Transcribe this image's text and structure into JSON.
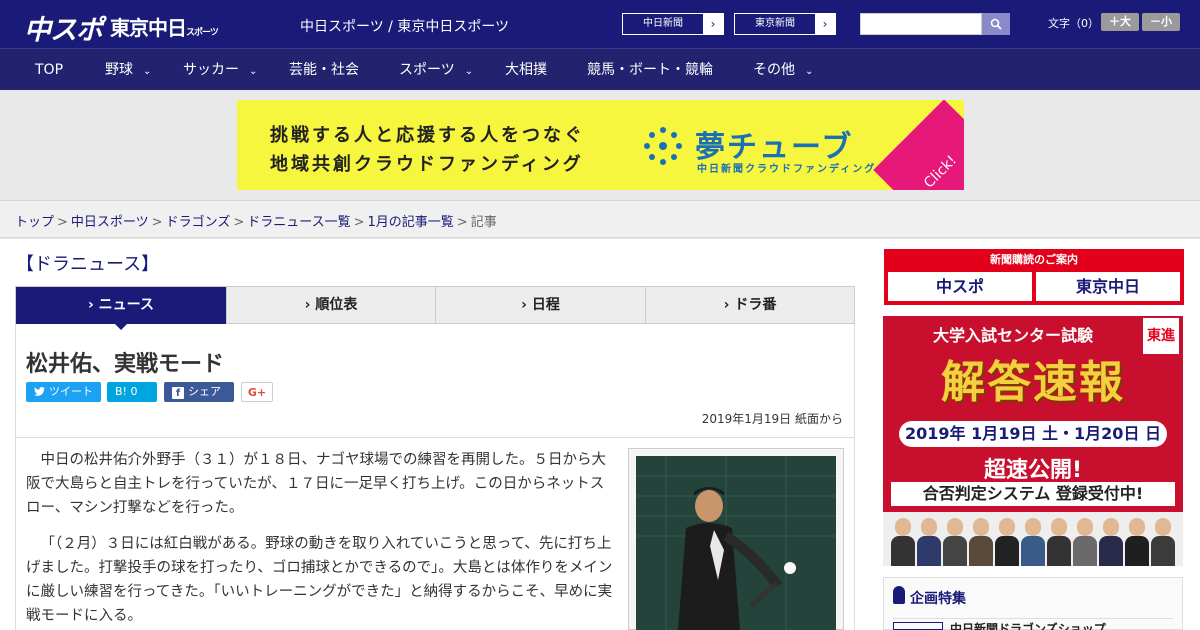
{
  "header": {
    "logo_chuspo": "中スポ",
    "logo_tokyo": "東京中日",
    "logo_tokyo_small": "スポーツ",
    "site_name": "中日スポーツ / 東京中日スポーツ",
    "links": [
      {
        "label": "中日新聞",
        "arrow": "›"
      },
      {
        "label": "東京新聞",
        "arrow": "›"
      }
    ],
    "search": {
      "placeholder": "",
      "icon": "search-icon",
      "button_symbol": "🔍"
    },
    "font_size_label": "文字（0）",
    "font_larger": "＋大",
    "font_smaller": "－小"
  },
  "nav": [
    {
      "label": "TOP",
      "has_dropdown": false
    },
    {
      "label": "野球",
      "has_dropdown": true
    },
    {
      "label": "サッカー",
      "has_dropdown": true
    },
    {
      "label": "芸能・社会",
      "has_dropdown": false
    },
    {
      "label": "スポーツ",
      "has_dropdown": true
    },
    {
      "label": "大相撲",
      "has_dropdown": false
    },
    {
      "label": "競馬・ボート・競輪",
      "has_dropdown": false
    },
    {
      "label": "その他",
      "has_dropdown": true
    }
  ],
  "nav_chevron": "⌄",
  "banner": {
    "line1": "挑戦する人と応援する人をつなぐ",
    "line2": "地域共創クラウドファンディング",
    "logo": "夢チューブ",
    "logo_sub": "中日新聞クラウドファンディング",
    "click": "Click!",
    "bg_color": "#f7f63e",
    "accent_color": "#e6197b"
  },
  "breadcrumb": {
    "items": [
      "トップ",
      "中日スポーツ",
      "ドラゴンズ",
      "ドラニュース一覧",
      "1月の記事一覧"
    ],
    "current": "記事",
    "separator": ">"
  },
  "section_title": "【ドラニュース】",
  "tabs": [
    {
      "label": "› ニュース",
      "active": true
    },
    {
      "label": "› 順位表",
      "active": false
    },
    {
      "label": "› 日程",
      "active": false
    },
    {
      "label": "› ドラ番",
      "active": false
    }
  ],
  "article": {
    "headline": "松井佑、実戦モード",
    "share": {
      "tweet": "ツイート",
      "hatena": "B! 0",
      "facebook": "シェア 0",
      "gplus": "G+"
    },
    "dateline": "2019年1月19日 紙面から",
    "paragraphs": [
      "中日の松井佑介外野手（３１）が１８日、ナゴヤ球場での練習を再開した。５日から大阪で大島らと自主トレを行っていたが、１７日に一足早く打ち上げ。この日からネットスロー、マシン打撃などを行った。",
      "「（２月）３日には紅白戦がある。野球の動きを取り入れていこうと思って、先に打ち上げました。打撃投手の球を打ったり、ゴロ捕球とかできるので」。大島とは体作りをメインに厳しい練習を行ってきた。「いいトレーニングができた」と納得するからこそ、早めに実戦モードに入る。"
    ]
  },
  "sidebar": {
    "subscribe_title": "新聞購読のご案内",
    "subscribe_logo1": "中スポ",
    "subscribe_logo2": "東京中日",
    "ad": {
      "title": "大学入試センター試験",
      "badge": "東進",
      "big": "解答速報",
      "date": "2019年 1月19日 土・1月20日 日",
      "fast": "超速公開!",
      "system": "合否判定システム 登録受付中!"
    },
    "feature_title": "企画特集",
    "feature_item": "中日新聞ドラゴンズショップ"
  },
  "colors": {
    "brand": "#1a1a78",
    "nav_bg": "#22226f",
    "red": "#e3001b"
  }
}
